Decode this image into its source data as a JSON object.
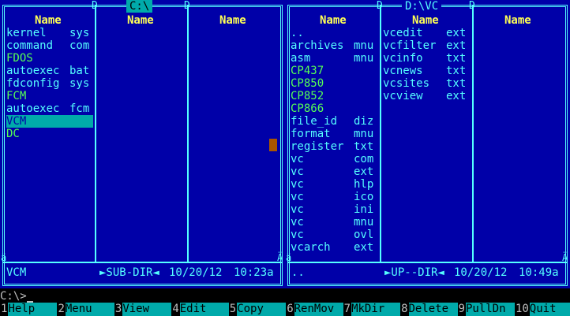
{
  "left_panel": {
    "title": "C:\\",
    "drive_tag_left": "D",
    "drive_tag_right": "D",
    "col_headers": [
      "Name",
      "Name",
      "Name"
    ],
    "files": [
      {
        "name": "kernel",
        "ext": "sys",
        "type": "file"
      },
      {
        "name": "command",
        "ext": "com",
        "type": "file"
      },
      {
        "name": "FDOS",
        "ext": "",
        "type": "dir"
      },
      {
        "name": "autoexec",
        "ext": "bat",
        "type": "file"
      },
      {
        "name": "fdconfig",
        "ext": "sys",
        "type": "file"
      },
      {
        "name": "FCM",
        "ext": "",
        "type": "dir"
      },
      {
        "name": "autoexec",
        "ext": "fcm",
        "type": "file"
      },
      {
        "name": "VCM",
        "ext": "",
        "type": "dir",
        "selected": true
      },
      {
        "name": "DC",
        "ext": "",
        "type": "dir"
      }
    ],
    "status_name": "VCM",
    "status_type": "►SUB-DIR◄",
    "status_date": "10/20/12",
    "status_time": "10:23a"
  },
  "right_panel": {
    "title": "D:\\VC",
    "col_headers": [
      "Name",
      "Name",
      "Name"
    ],
    "col1": [
      {
        "name": "..",
        "ext": "",
        "type": "file"
      },
      {
        "name": "archives",
        "ext": "mnu",
        "type": "file"
      },
      {
        "name": "asm",
        "ext": "mnu",
        "type": "file"
      },
      {
        "name": "CP437",
        "ext": "",
        "type": "dir"
      },
      {
        "name": "CP850",
        "ext": "",
        "type": "dir"
      },
      {
        "name": "CP852",
        "ext": "",
        "type": "dir"
      },
      {
        "name": "CP866",
        "ext": "",
        "type": "dir"
      },
      {
        "name": "file_id",
        "ext": "diz",
        "type": "file"
      },
      {
        "name": "format",
        "ext": "mnu",
        "type": "file"
      },
      {
        "name": "register",
        "ext": "txt",
        "type": "file"
      },
      {
        "name": "vc",
        "ext": "com",
        "type": "file"
      },
      {
        "name": "vc",
        "ext": "ext",
        "type": "file"
      },
      {
        "name": "vc",
        "ext": "hlp",
        "type": "file"
      },
      {
        "name": "vc",
        "ext": "ico",
        "type": "file"
      },
      {
        "name": "vc",
        "ext": "ini",
        "type": "file"
      },
      {
        "name": "vc",
        "ext": "mnu",
        "type": "file"
      },
      {
        "name": "vc",
        "ext": "ovl",
        "type": "file"
      },
      {
        "name": "vcarch",
        "ext": "ext",
        "type": "file"
      }
    ],
    "col2": [
      {
        "name": "vcedit",
        "ext": "ext",
        "type": "file"
      },
      {
        "name": "vcfilter",
        "ext": "ext",
        "type": "file"
      },
      {
        "name": "vcinfo",
        "ext": "txt",
        "type": "file"
      },
      {
        "name": "vcnews",
        "ext": "txt",
        "type": "file"
      },
      {
        "name": "vcsites",
        "ext": "txt",
        "type": "file"
      },
      {
        "name": "vcview",
        "ext": "ext",
        "type": "file"
      }
    ],
    "status_name": "..",
    "status_type": "►UP--DIR◄",
    "status_date": "10/20/12",
    "status_time": "10:49a"
  },
  "command_line": {
    "prompt": "C:\\>"
  },
  "function_keys": [
    {
      "num": "1",
      "label": "Help"
    },
    {
      "num": "2",
      "label": "Menu"
    },
    {
      "num": "3",
      "label": "View"
    },
    {
      "num": "4",
      "label": "Edit"
    },
    {
      "num": "5",
      "label": "Copy"
    },
    {
      "num": "6",
      "label": "RenMov"
    },
    {
      "num": "7",
      "label": "MkDir"
    },
    {
      "num": "8",
      "label": "Delete"
    },
    {
      "num": "9",
      "label": "PullDn"
    },
    {
      "num": "10",
      "label": "Quit"
    }
  ],
  "colors": {
    "panel_bg": "#0000a8",
    "text": "#55ffff",
    "dir": "#55ff55",
    "header": "#ffff55",
    "selection": "#00aaaa"
  }
}
